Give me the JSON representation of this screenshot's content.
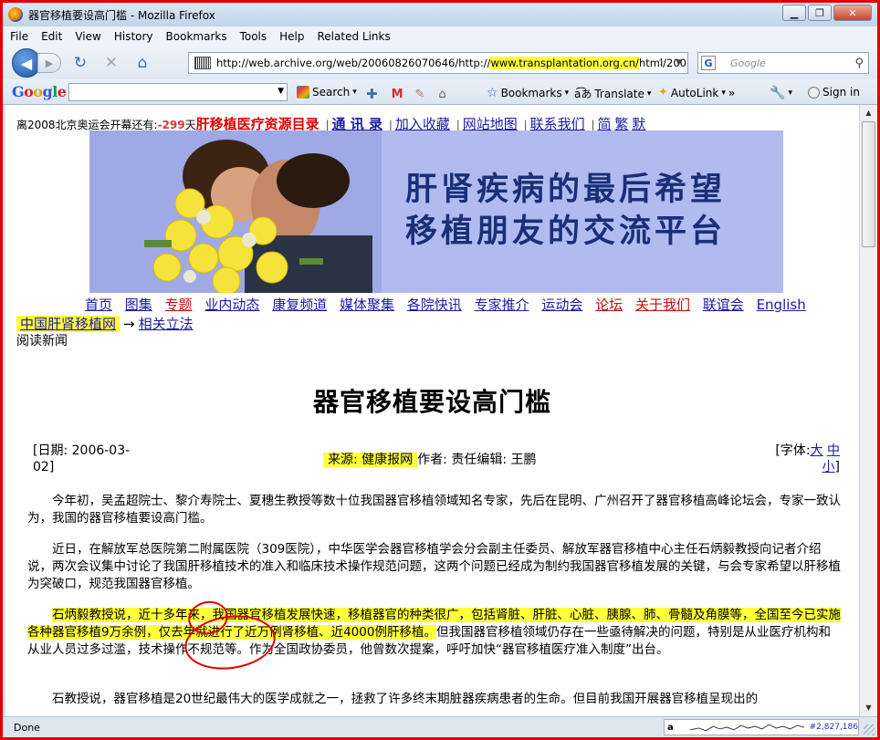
{
  "window": {
    "title": "器官移植要设高门槛 - Mozilla Firefox"
  },
  "menu": [
    "File",
    "Edit",
    "View",
    "History",
    "Bookmarks",
    "Tools",
    "Help",
    "Related Links"
  ],
  "navbar": {
    "url_prefix": "http://web.archive.org/web/20060826070646/http://",
    "url_highlight": "www.transplantation.org.cn/",
    "url_suffix": "html/200",
    "search_placeholder": "Google"
  },
  "google_toolbar": {
    "logo": "Google",
    "search_label": "Search",
    "bookmarks_label": "Bookmarks",
    "translate_label": "Translate",
    "autolink_label": "AutoLink",
    "more_label": "»",
    "signin_label": "Sign in"
  },
  "page": {
    "olympic_prefix": "离2008北京奥运会开幕还有:",
    "olympic_days": "-299",
    "olympic_suffix": "天",
    "resource_dir": "肝移植医疗资源目录",
    "contacts": "通 讯 录",
    "add_fav": "加入收藏",
    "sitemap": "网站地图",
    "contact_us": "联系我们",
    "simplified": "简",
    "traditional": "繁",
    "default": "默",
    "banner_line1": "肝肾疾病的最后希望",
    "banner_line2": "移植朋友的交流平台",
    "nav_links": [
      "首页",
      "图集",
      "专题",
      "业内动态",
      "康复频道",
      "媒体聚集",
      "各院快讯",
      "专家推介",
      "运动会",
      "论坛",
      "关于我们",
      "联谊会",
      "English"
    ],
    "crumb_home": "中国肝肾移植网",
    "crumb_arrow": "→",
    "crumb_section": "相关立法",
    "read_news": "阅读新闻",
    "article_title": "器官移植要设高门槛",
    "date_text": "[日期: 2006-03-02]",
    "source_text": "来源: 健康报网",
    "author_text": "作者: 责任编辑: 王鹏",
    "font_label": "[字体:",
    "font_large": "大",
    "font_medium": "中",
    "font_small": "小",
    "font_close": "]",
    "para1": "今年初，吴孟超院士、黎介寿院士、夏穗生教授等数十位我国器官移植领域知名专家，先后在昆明、广州召开了器官移植高峰论坛会，专家一致认为，我国的器官移植要设高门槛。",
    "para2": "近日，在解放军总医院第二附属医院（309医院），中华医学会器官移植学会分会副主任委员、解放军器官移植中心主任石炳毅教授向记者介绍说，两次会议集中讨论了我国肝移植技术的准入和临床技术操作规范问题，这两个问题已经成为制约我国器官移植发展的关键，与会专家希望以肝移植为突破口，规范我国器官移植。",
    "para3_hl": "石炳毅教授说，近十多年来，我国器官移植发展快速，移植器官的种类很广，包括肾脏、肝脏、心脏、胰腺、肺、骨髓及角膜等，全国至今已实施各种器官移植9万余例，仅去年就进行了近万例肾移植、近4000例肝移植。",
    "para3_rest": "但我国器官移植领域仍存在一些亟待解决的问题，特别是从业医疗机构和从业人员过多过滥，技术操作不规范等。作为全国政协委员，他曾数次提案，呼吁加快“器官移植医疗准入制度”出台。",
    "para4": "石教授说，器官移植是20世纪最伟大的医学成就之一，拯救了许多终末期脏器疾病患者的生命。但目前我国开展器官移植呈现出的"
  },
  "status": {
    "text": "Done",
    "count": "#2,827,186"
  }
}
